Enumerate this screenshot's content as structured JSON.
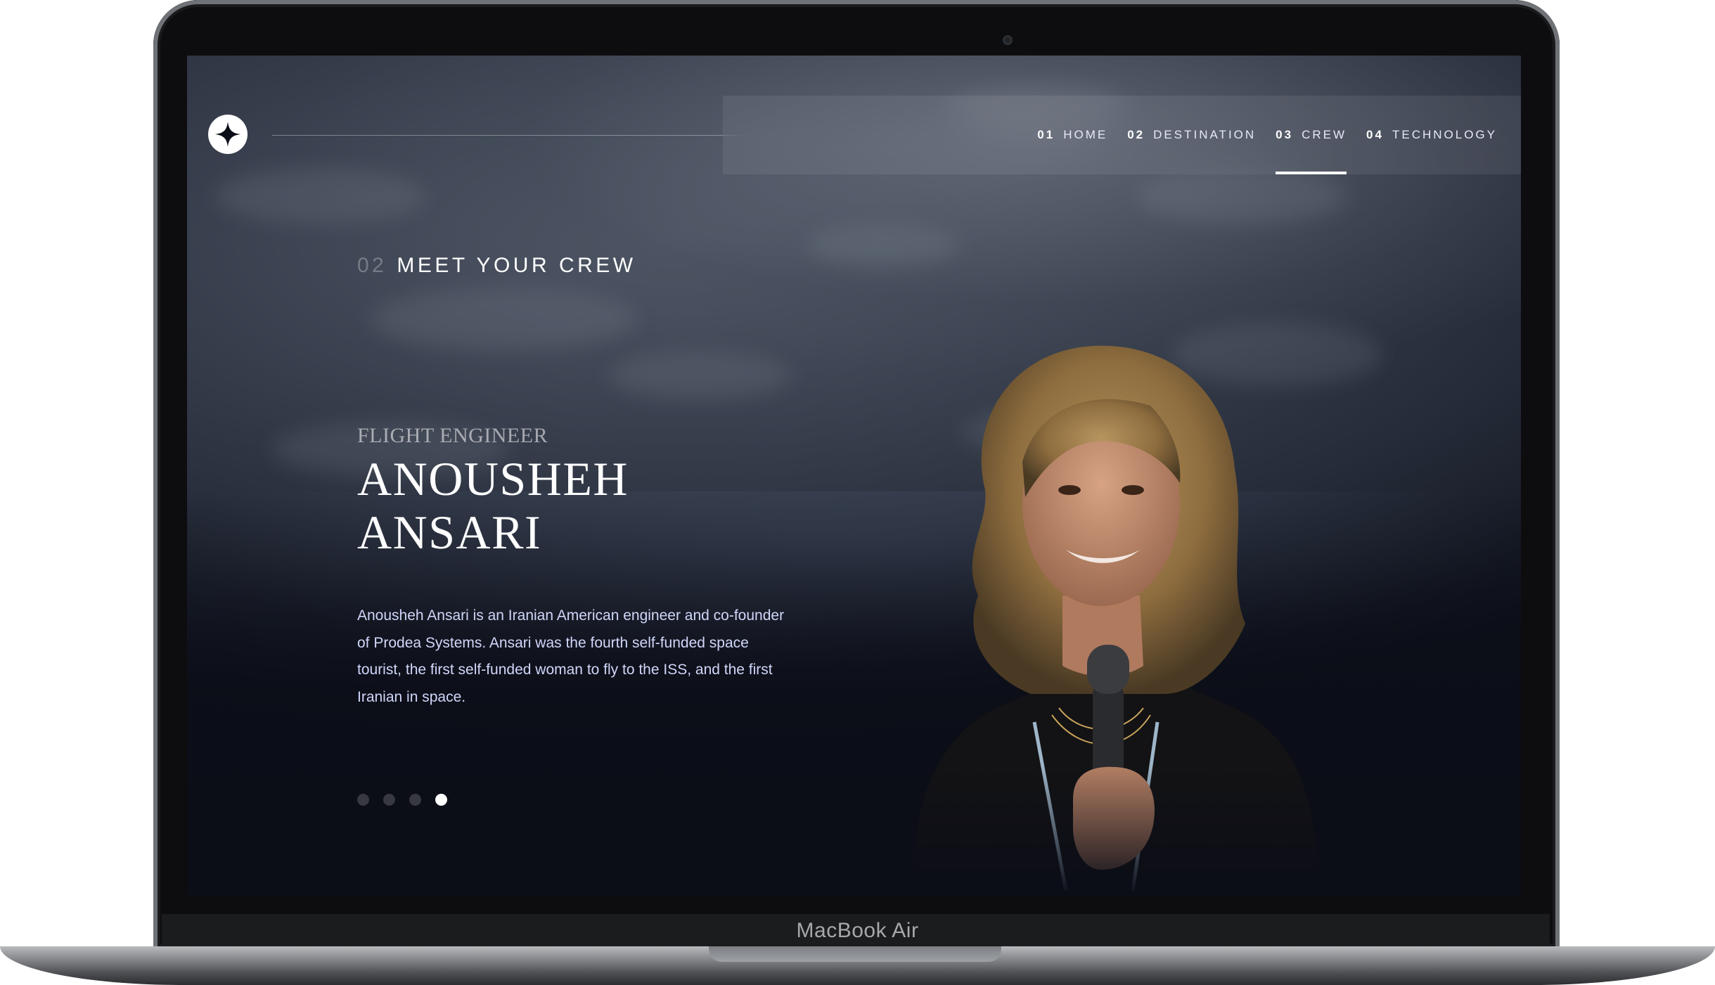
{
  "device": {
    "brand_label": "MacBook Air"
  },
  "nav": {
    "items": [
      {
        "number": "01",
        "label": "HOME",
        "active": false
      },
      {
        "number": "02",
        "label": "DESTINATION",
        "active": false
      },
      {
        "number": "03",
        "label": "CREW",
        "active": true
      },
      {
        "number": "04",
        "label": "TECHNOLOGY",
        "active": false
      }
    ]
  },
  "page": {
    "eyebrow_number": "02",
    "eyebrow_label": "MEET YOUR CREW"
  },
  "crew": {
    "role": "FLIGHT ENGINEER",
    "name_line1": "ANOUSHEH",
    "name_line2": "ANSARI",
    "bio": "Anousheh Ansari is an Iranian American engineer and co-founder of Prodea Systems. Ansari was the fourth self-funded space tourist, the first self-funded woman to fly to the ISS, and the first Iranian in space.",
    "slide_count": 4,
    "active_slide": 4
  },
  "colors": {
    "background": "#0b0d17",
    "text_light": "#d0d6f9",
    "white": "#ffffff"
  },
  "icons": {
    "logo": "star-logo-icon"
  }
}
